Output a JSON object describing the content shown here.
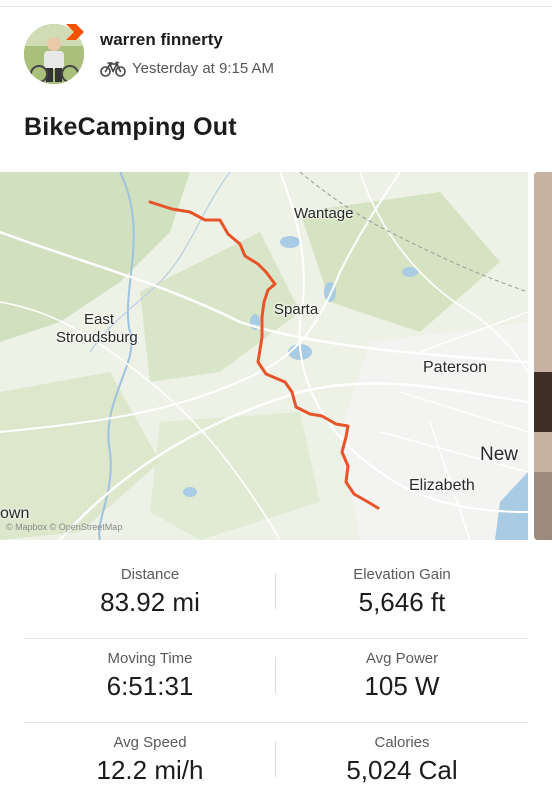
{
  "post": {
    "athlete_name": "warren finnerty",
    "activity_icon": "bike-icon",
    "timestamp": "Yesterday at 9:15 AM",
    "title": "BikeCamping Out"
  },
  "map": {
    "labels": [
      "Wantage",
      "East Stroudsburg",
      "Sparta",
      "Paterson",
      "New",
      "Elizabeth",
      "own"
    ],
    "attribution": "© Mapbox © OpenStreetMap",
    "route_color": "#e8542a"
  },
  "stats": [
    {
      "left": {
        "label": "Distance",
        "value": "83.92 mi"
      },
      "right": {
        "label": "Elevation Gain",
        "value": "5,646 ft"
      }
    },
    {
      "left": {
        "label": "Moving Time",
        "value": "6:51:31"
      },
      "right": {
        "label": "Avg Power",
        "value": "105 W"
      }
    },
    {
      "left": {
        "label": "Avg Speed",
        "value": "12.2 mi/h"
      },
      "right": {
        "label": "Calories",
        "value": "5,024 Cal"
      }
    }
  ],
  "colors": {
    "brand_orange": "#fc5200"
  }
}
